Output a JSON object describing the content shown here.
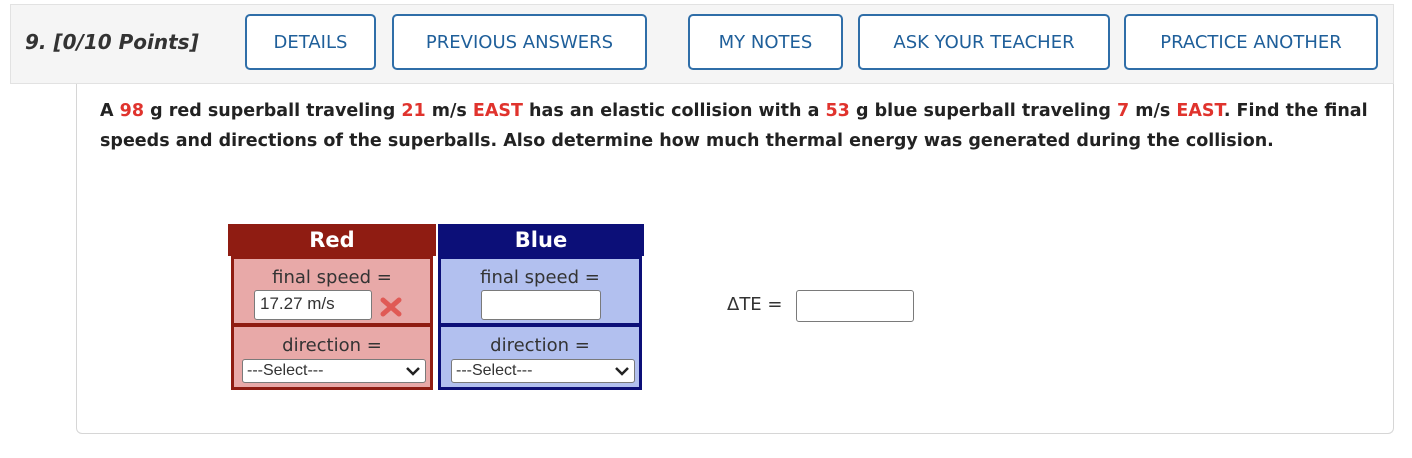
{
  "header": {
    "question_label": "9.  [0/10 Points]",
    "buttons": {
      "details": "DETAILS",
      "previous_answers": "PREVIOUS ANSWERS",
      "my_notes": "MY NOTES",
      "ask_teacher": "ASK YOUR TEACHER",
      "practice_another": "PRACTICE ANOTHER"
    }
  },
  "question": {
    "parts": [
      "A ",
      "98",
      " g red superball traveling ",
      "21",
      " m/s ",
      "EAST",
      " has an elastic collision with a ",
      "53",
      " g blue superball traveling ",
      "7",
      " m/s ",
      "EAST",
      ".",
      " Find the final speeds and directions of the superballs. Also determine how much thermal energy was generated during the collision."
    ]
  },
  "red": {
    "title": "Red",
    "final_speed_label": "final speed =",
    "final_speed_value": "17.27 m/s",
    "final_speed_status": "incorrect",
    "direction_label": "direction =",
    "direction_selected": "---Select---"
  },
  "blue": {
    "title": "Blue",
    "final_speed_label": "final speed =",
    "final_speed_value": "",
    "direction_label": "direction =",
    "direction_selected": "---Select---"
  },
  "thermal": {
    "label": "ΔTE =",
    "value": ""
  },
  "colors": {
    "red_header": "#8f1c12",
    "red_cell": "#e8a9a8",
    "blue_header": "#0c0f78",
    "blue_cell": "#b2c0ef",
    "highlight": "#e0332d",
    "button_border": "#2f6ea8"
  }
}
